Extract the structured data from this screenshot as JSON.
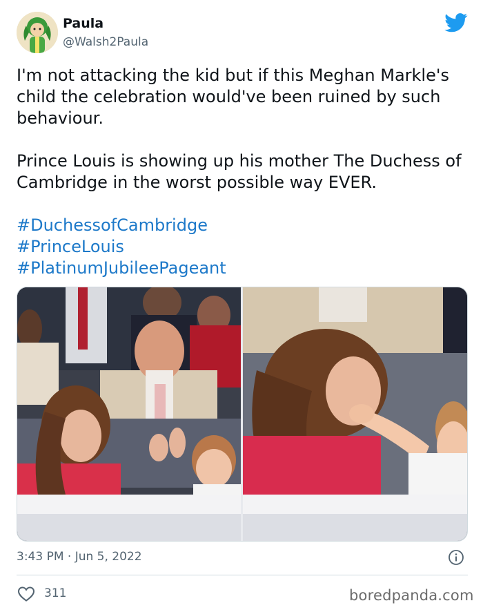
{
  "author": {
    "name": "Paula",
    "handle": "@Walsh2Paula",
    "avatar_icon": "green-cartoon-avatar-icon"
  },
  "platform_icon": "twitter-bird-icon",
  "tweet": {
    "paragraph_1": "I'm not attacking the kid but if this Meghan Markle's child the celebration would've been ruined by such behaviour.",
    "paragraph_2": "Prince Louis is showing up his mother The Duchess of Cambridge in the worst possible way EVER.",
    "hashtags": [
      "#DuchessofCambridge",
      "#PrinceLouis",
      "#PlatinumJubileePageant"
    ]
  },
  "media": {
    "photo_count": 2
  },
  "timestamp": "3:43 PM · Jun 5, 2022",
  "likes": "311",
  "watermark": "boredpanda.com",
  "colors": {
    "link": "#1d79c9",
    "twitter_blue": "#1d9bf0",
    "secondary_text": "#536471",
    "divider": "#cfd9de"
  }
}
